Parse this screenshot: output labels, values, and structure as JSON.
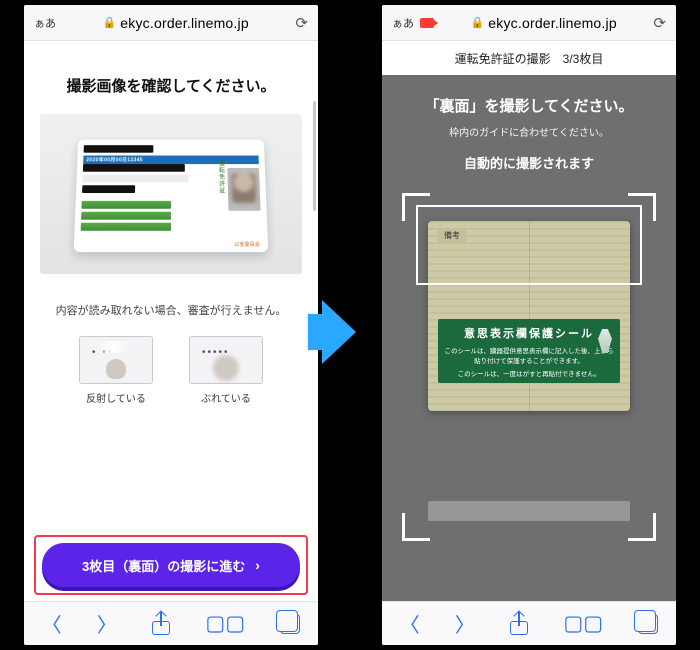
{
  "browser": {
    "aa": "ぁあ",
    "url": "ekyc.order.linemo.jp"
  },
  "left": {
    "heading": "撮影画像を確認してください。",
    "license_number": "2020年00月00日12345",
    "license_side": "運転免許証",
    "license_stamp": "公安委員会",
    "note": "内容が読み取れない場合、審査が行えません。",
    "thumbs": [
      {
        "caption": "反射している"
      },
      {
        "caption": "ぶれている"
      }
    ],
    "cta": "3枚目（裏面）の撮影に進む"
  },
  "right": {
    "step_label": "運転免許証の撮影",
    "step_count": "3/3枚目",
    "heading": "「裏面」を撮影してください。",
    "sub": "枠内のガイドに合わせてください。",
    "auto": "自動的に撮影されます",
    "backcard_header": "備考",
    "seal_title": "意思表示欄保護シール",
    "seal_line1": "このシールは、臓器提供意思表示欄に記入した後、上から貼り付けて保護することができます。",
    "seal_line2": "このシールは、一度はがすと再貼付できません。"
  }
}
